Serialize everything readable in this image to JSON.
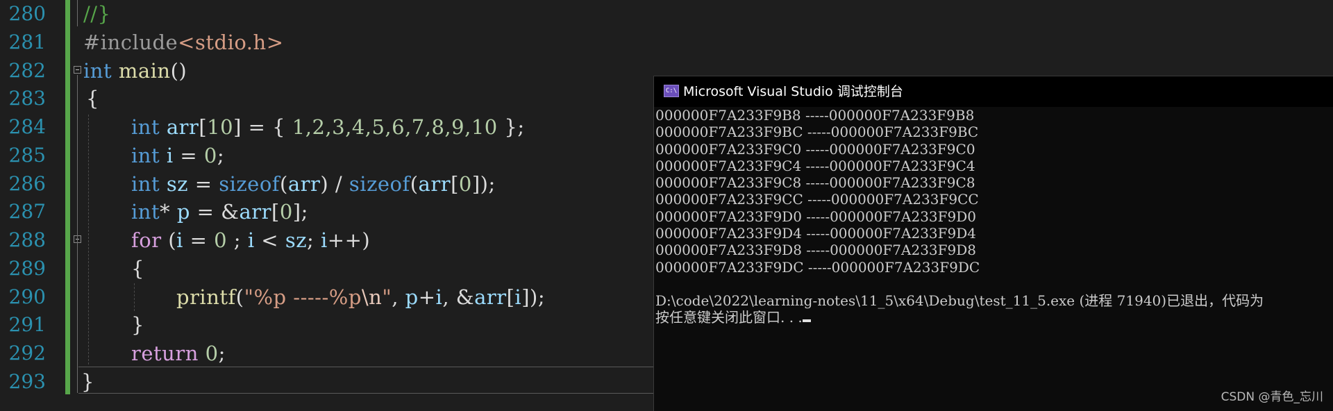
{
  "editor": {
    "lines": [
      {
        "n": "280"
      },
      {
        "n": "281"
      },
      {
        "n": "282"
      },
      {
        "n": "283"
      },
      {
        "n": "284"
      },
      {
        "n": "285"
      },
      {
        "n": "286"
      },
      {
        "n": "287"
      },
      {
        "n": "288"
      },
      {
        "n": "289"
      },
      {
        "n": "290"
      },
      {
        "n": "291"
      },
      {
        "n": "292"
      },
      {
        "n": "293"
      }
    ],
    "code": {
      "l280": {
        "cmt": "//}"
      },
      "l281": {
        "inc": "#include",
        "hdr": "<stdio.h>"
      },
      "l282": {
        "kw": "int",
        "fn": "main",
        "rest": "()"
      },
      "l283": {
        "t": "{"
      },
      "l284": {
        "kw": "int",
        "var": "arr",
        "b1": "[",
        "n1": "10",
        "b2": "] = { ",
        "vals": "1,2,3,4,5,6,7,8,9,10",
        "end": " };"
      },
      "l285": {
        "kw": "int",
        "var": "i",
        "eq": " = ",
        "num": "0",
        "end": ";"
      },
      "l286": {
        "kw": "int",
        "var": "sz",
        "eq": " = ",
        "f1": "sizeof",
        "a1": "(",
        "v1": "arr",
        "a2": ") / ",
        "f2": "sizeof",
        "a3": "(",
        "v2": "arr",
        "a4": "[",
        "n0": "0",
        "a5": "]);"
      },
      "l287": {
        "kw": "int",
        "star": "* ",
        "var": "p",
        "eq": " = &",
        "v": "arr",
        "a": "[",
        "n": "0",
        "e": "];"
      },
      "l288": {
        "kw": "for",
        "p1": " (",
        "v1": "i",
        "eq": " = ",
        "n0": "0",
        "s1": " ; ",
        "v2": "i",
        "lt": " < ",
        "v3": "sz",
        "s2": "; ",
        "v4": "i",
        "pp": "++)"
      },
      "l289": {
        "t": "{"
      },
      "l290": {
        "fn": "printf",
        "p": "(",
        "s1": "\"%p -----%p",
        "esc": "\\n",
        "s2": "\"",
        "c": ", ",
        "v1": "p",
        "plus": "+",
        "v2": "i",
        "c2": ", &",
        "v3": "arr",
        "b": "[",
        "v4": "i",
        "e": "]);"
      },
      "l291": {
        "t": "}"
      },
      "l292": {
        "kw": "return",
        "sp": " ",
        "n": "0",
        "e": ";"
      },
      "l293": {
        "t": "}"
      }
    }
  },
  "console": {
    "title": "Microsoft Visual Studio 调试控制台",
    "icon": "console-app-icon",
    "rows": [
      "000000F7A233F9B8 -----000000F7A233F9B8",
      "000000F7A233F9BC -----000000F7A233F9BC",
      "000000F7A233F9C0 -----000000F7A233F9C0",
      "000000F7A233F9C4 -----000000F7A233F9C4",
      "000000F7A233F9C8 -----000000F7A233F9C8",
      "000000F7A233F9CC -----000000F7A233F9CC",
      "000000F7A233F9D0 -----000000F7A233F9D0",
      "000000F7A233F9D4 -----000000F7A233F9D4",
      "000000F7A233F9D8 -----000000F7A233F9D8",
      "000000F7A233F9DC -----000000F7A233F9DC"
    ],
    "exit_line": "D:\\code\\2022\\learning-notes\\11_5\\x64\\Debug\\test_11_5.exe (进程 71940)已退出，代码为",
    "prompt_line": "按任意键关闭此窗口. . ."
  },
  "watermark": "CSDN @青色_忘川",
  "colors": {
    "keyword": "#569cd6",
    "control": "#d8a0df",
    "function": "#dcdcaa",
    "variable": "#9cdcfe",
    "number": "#b5cea8",
    "string": "#d69d85",
    "comment": "#57a64a",
    "line_number": "#2b91af"
  }
}
